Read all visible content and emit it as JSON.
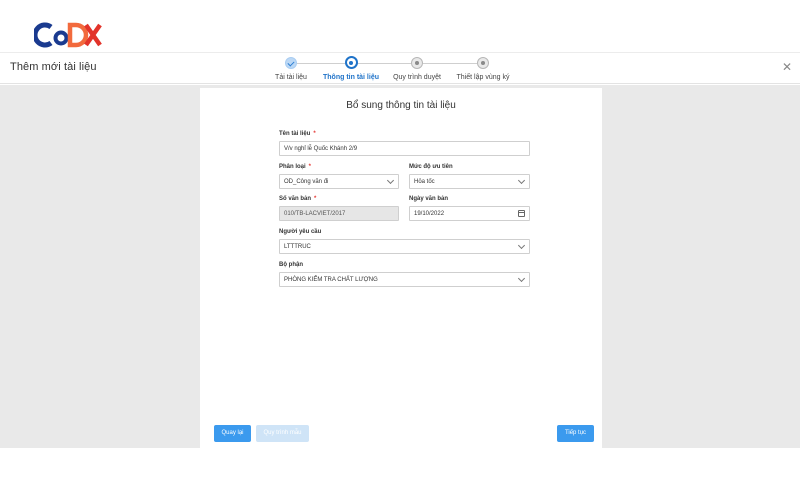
{
  "colors": {
    "primary": "#3b9aee",
    "active_step": "#1f73c9",
    "required": "#e53935",
    "logo_blue": "#1a3a8f",
    "logo_orange": "#f26a3d",
    "logo_red": "#e2332a"
  },
  "header": {
    "title": "Thêm mới tài liệu",
    "close_icon": "close-icon"
  },
  "steps": [
    {
      "label": "Tải tài liệu",
      "state": "done"
    },
    {
      "label": "Thông tin tài liệu",
      "state": "active"
    },
    {
      "label": "Quy trình duyệt",
      "state": "pending"
    },
    {
      "label": "Thiết lập vùng ký",
      "state": "pending"
    }
  ],
  "form": {
    "title": "Bổ sung thông tin tài liệu",
    "name_label": "Tên tài liệu",
    "name_value": "V/v nghỉ lễ Quốc Khánh 2/9",
    "category_label": "Phân loại",
    "category_value": "OD_Công văn đi",
    "priority_label": "Mức độ ưu tiên",
    "priority_value": "Hỏa tốc",
    "doc_number_label": "Số văn bản",
    "doc_number_value": "010/TB-LACVIET/2017",
    "date_label": "Ngày văn bản",
    "date_value": "19/10/2022",
    "requester_label": "Người yêu cầu",
    "requester_value": "LTTTRUC",
    "department_label": "Bộ phận",
    "department_value": "PHÒNG KIỂM TRA CHẤT LƯỢNG",
    "required_mark": "*"
  },
  "footer": {
    "back_label": "Quay lại",
    "template_label": "Quy trình mẫu",
    "next_label": "Tiếp tục"
  }
}
